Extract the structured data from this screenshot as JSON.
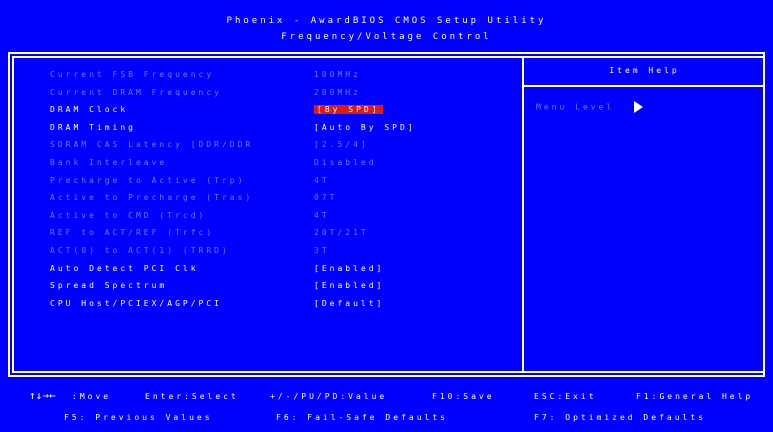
{
  "header": {
    "title": "Phoenix - AwardBIOS CMOS Setup Utility",
    "subtitle": "Frequency/Voltage Control"
  },
  "settings": [
    {
      "label": "Current FSB Frequency",
      "value": "100MHz",
      "state": "dim"
    },
    {
      "label": "Current DRAM Frequency",
      "value": "200MHz",
      "state": "dim"
    },
    {
      "label": "DRAM Clock",
      "value": "[By SPD]",
      "state": "selected"
    },
    {
      "label": "DRAM Timing",
      "value": "[Auto By SPD]",
      "state": "bright"
    },
    {
      "label": "SDRAM CAS Latency [DDR/DDR",
      "value": "[2.5/4]",
      "state": "dim"
    },
    {
      "label": "Bank Interleave",
      "value": "Disabled",
      "state": "dim"
    },
    {
      "label": "Precharge to Active (Trp)",
      "value": "4T",
      "state": "dim"
    },
    {
      "label": "Active to Precharge (Tras)",
      "value": "07T",
      "state": "dim"
    },
    {
      "label": "Active to CMD (Trcd)",
      "value": "4T",
      "state": "dim"
    },
    {
      "label": "REF to ACT/REF (Trfc)",
      "value": "20T/21T",
      "state": "dim"
    },
    {
      "label": "ACT(0) to ACT(1) (TRRD)",
      "value": "3T",
      "state": "dim"
    },
    {
      "label": "Auto Detect PCI Clk",
      "value": "[Enabled]",
      "state": "bright"
    },
    {
      "label": "Spread Spectrum",
      "value": "[Enabled]",
      "state": "bright"
    },
    {
      "label": "CPU Host/PCIEX/AGP/PCI",
      "value": "[Default]",
      "state": "bright"
    }
  ],
  "help_panel": {
    "title": "Item Help",
    "menu_level_label": "Menu Level",
    "menu_level_icon": "right-triangle-icon"
  },
  "footer": {
    "arrows_glyph": "↑↓→←",
    "move": ":Move",
    "enter": "Enter:Select",
    "value": "+/-/PU/PD:Value",
    "f10": "F10:Save",
    "esc": "ESC:Exit",
    "f1": "F1:General Help",
    "f5": "F5: Previous Values",
    "f6": "F6: Fail-Safe Defaults",
    "f7": "F7: Optimized Defaults"
  },
  "colors": {
    "background": "#0000ff",
    "text_bright": "#ffffff",
    "text_dim": "#6f7cff",
    "selection": "#e01a10"
  }
}
